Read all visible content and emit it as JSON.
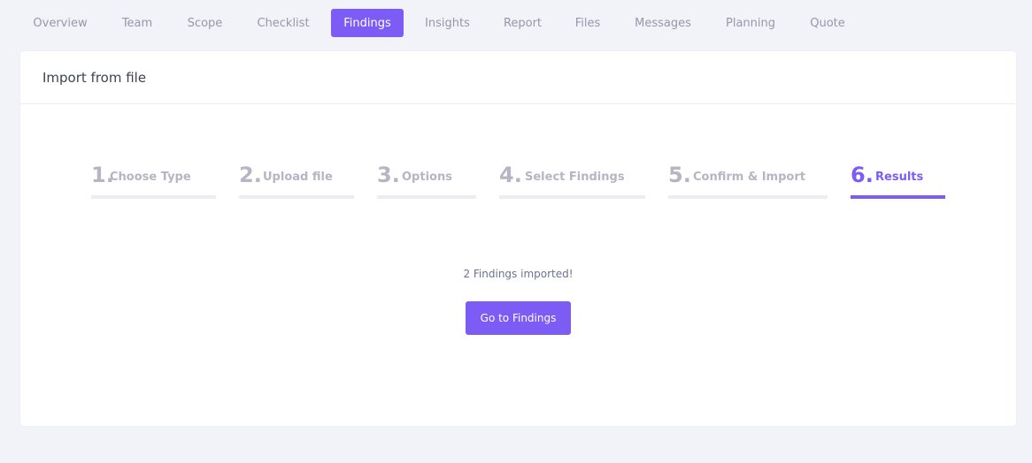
{
  "nav": {
    "tabs": [
      {
        "label": "Overview"
      },
      {
        "label": "Team"
      },
      {
        "label": "Scope"
      },
      {
        "label": "Checklist"
      },
      {
        "label": "Findings",
        "active": true
      },
      {
        "label": "Insights"
      },
      {
        "label": "Report"
      },
      {
        "label": "Files"
      },
      {
        "label": "Messages"
      },
      {
        "label": "Planning"
      },
      {
        "label": "Quote"
      }
    ]
  },
  "card": {
    "title": "Import from file"
  },
  "wizard": {
    "steps": [
      {
        "number": "1.",
        "label": "Choose Type"
      },
      {
        "number": "2.",
        "label": "Upload file"
      },
      {
        "number": "3.",
        "label": "Options"
      },
      {
        "number": "4.",
        "label": "Select Findings"
      },
      {
        "number": "5.",
        "label": "Confirm & Import"
      },
      {
        "number": "6.",
        "label": "Results",
        "active": true
      }
    ]
  },
  "result": {
    "message": "2 Findings imported!",
    "button_label": "Go to Findings"
  },
  "colors": {
    "accent": "#7c5cf5",
    "inactive_text": "#b5b5c3",
    "background": "#f2f3f8"
  }
}
